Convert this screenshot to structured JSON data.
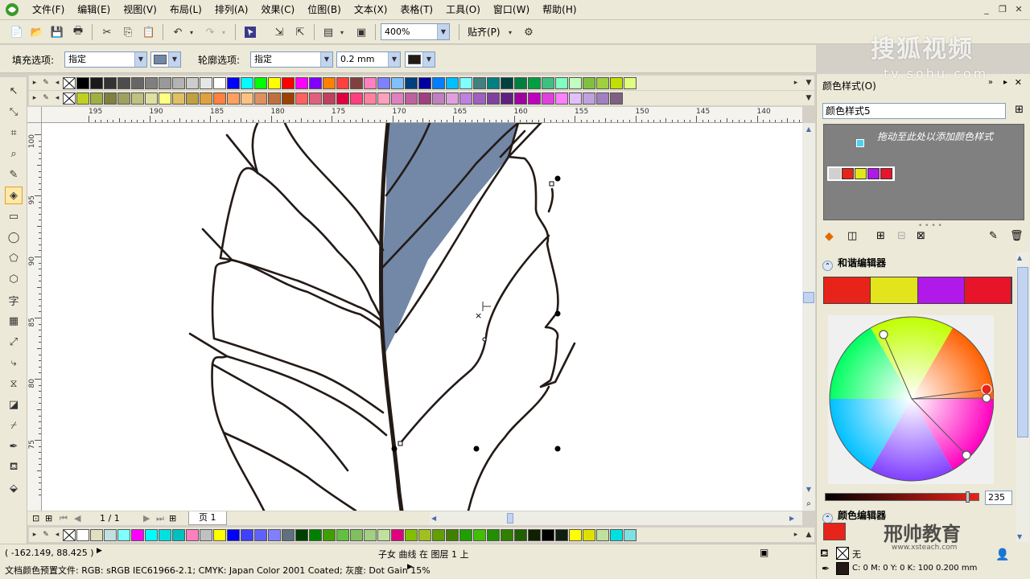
{
  "menu": [
    "文件(F)",
    "编辑(E)",
    "视图(V)",
    "布局(L)",
    "排列(A)",
    "效果(C)",
    "位图(B)",
    "文本(X)",
    "表格(T)",
    "工具(O)",
    "窗口(W)",
    "帮助(H)"
  ],
  "toolbar": {
    "zoom": "400%",
    "snap_label": "贴齐(P)"
  },
  "propbar": {
    "fill_label": "填充选项:",
    "fill_value": "指定",
    "fill_color": "#7387a6",
    "outline_label": "轮廓选项:",
    "outline_value": "指定",
    "outline_width": "0.2 mm",
    "outline_color": "#231a16"
  },
  "palettes": {
    "top1": [
      "#000000",
      "#1a1a1a",
      "#333333",
      "#4d4d4d",
      "#666666",
      "#808080",
      "#999999",
      "#b3b3b3",
      "#cccccc",
      "#e6e6e6",
      "#ffffff",
      "#0000ff",
      "#00ffff",
      "#00ff00",
      "#ffff00",
      "#ff0000",
      "#ff00ff",
      "#8000ff",
      "#ff8000",
      "#ff4040",
      "#804040",
      "#ff80c0",
      "#8080ff",
      "#80c0ff",
      "#004080",
      "#0000a0",
      "#0080ff",
      "#00c0ff",
      "#80ffff",
      "#408080",
      "#008080",
      "#004040",
      "#008040",
      "#00a040",
      "#40c080",
      "#80ffc0",
      "#c0ffc0",
      "#80c040",
      "#a0d040",
      "#c0e000",
      "#e0ff80"
    ],
    "top2": [
      "#c0d020",
      "#a0b040",
      "#808040",
      "#a0a060",
      "#c0c080",
      "#e0e0a0",
      "#ffff80",
      "#e0c060",
      "#c0a040",
      "#e0a040",
      "#ff8040",
      "#ffa060",
      "#ffc080",
      "#e09060",
      "#c07040",
      "#a04000",
      "#ff6060",
      "#e06080",
      "#c04060",
      "#e00040",
      "#ff4080",
      "#ff80a0",
      "#ffa0c0",
      "#e080c0",
      "#c060a0",
      "#a04080",
      "#c080c0",
      "#e0a0e0",
      "#c080e0",
      "#a060c0",
      "#8040a0",
      "#602080",
      "#a000a0",
      "#c000c0",
      "#e040e0",
      "#ff80ff",
      "#e0c0ff",
      "#c0a0e0",
      "#a080c0",
      "#806080"
    ],
    "bottom": [
      "#ffffff",
      "#e0e0c0",
      "#c0e0e0",
      "#80ffff",
      "#ff00ff",
      "#00ffff",
      "#00e0e0",
      "#00c0c0",
      "#ff80c0",
      "#c0c0c0",
      "#ffff00",
      "#0000ff",
      "#4040ff",
      "#6060ff",
      "#8080ff",
      "#607080",
      "#004000",
      "#008000",
      "#40a000",
      "#60c040",
      "#80c060",
      "#a0d080",
      "#c0e0a0",
      "#e00080",
      "#80c000",
      "#a0c020",
      "#60a000",
      "#408000",
      "#20a000",
      "#40c000",
      "#209000",
      "#308000",
      "#206000",
      "#102000",
      "#000000",
      "#102010",
      "#ffff00",
      "#e0e000",
      "#c0e0a0",
      "#00e0e0",
      "#80e0e0"
    ]
  },
  "ruler_h": [
    "195",
    "190",
    "185",
    "180",
    "175",
    "170",
    "165",
    "160",
    "155",
    "150",
    "145",
    "140"
  ],
  "ruler_v": [
    "100",
    "95",
    "90",
    "85",
    "80",
    "75"
  ],
  "pagenav": {
    "page_count": "1 / 1",
    "page_tab": "页 1"
  },
  "status": {
    "coords": "( -162.149, 88.425 )",
    "object_info": "子女 曲线 在 图层 1 上",
    "color_profile": "文档颜色预置文件: RGB: sRGB IEC61966-2.1; CMYK: Japan Color 2001 Coated; 灰度: Dot Gain 15%",
    "fill_none": "无",
    "outline_info": "C: 0 M: 0 Y: 0 K: 100  0.200 mm"
  },
  "docker": {
    "title": "颜色样式(O)",
    "style_name": "颜色样式5",
    "drop_hint": "拖动至此处以添加颜色样式",
    "harmony_title": "和谐编辑器",
    "harmony_colors": [
      "#e8231a",
      "#e4e41c",
      "#b019e8",
      "#e8142a"
    ],
    "style_chips": [
      "#e8231a",
      "#e4e41c",
      "#b019e8",
      "#e8142a"
    ],
    "brightness": "235",
    "color_editor_title": "颜色编辑器",
    "editor_color": "#e8231a"
  },
  "watermarks": {
    "top": "搜狐视频",
    "top_sub": "tv.sohu.com",
    "bottom": "邢帅教育",
    "bottom_sub": "www.xsteach.com"
  }
}
